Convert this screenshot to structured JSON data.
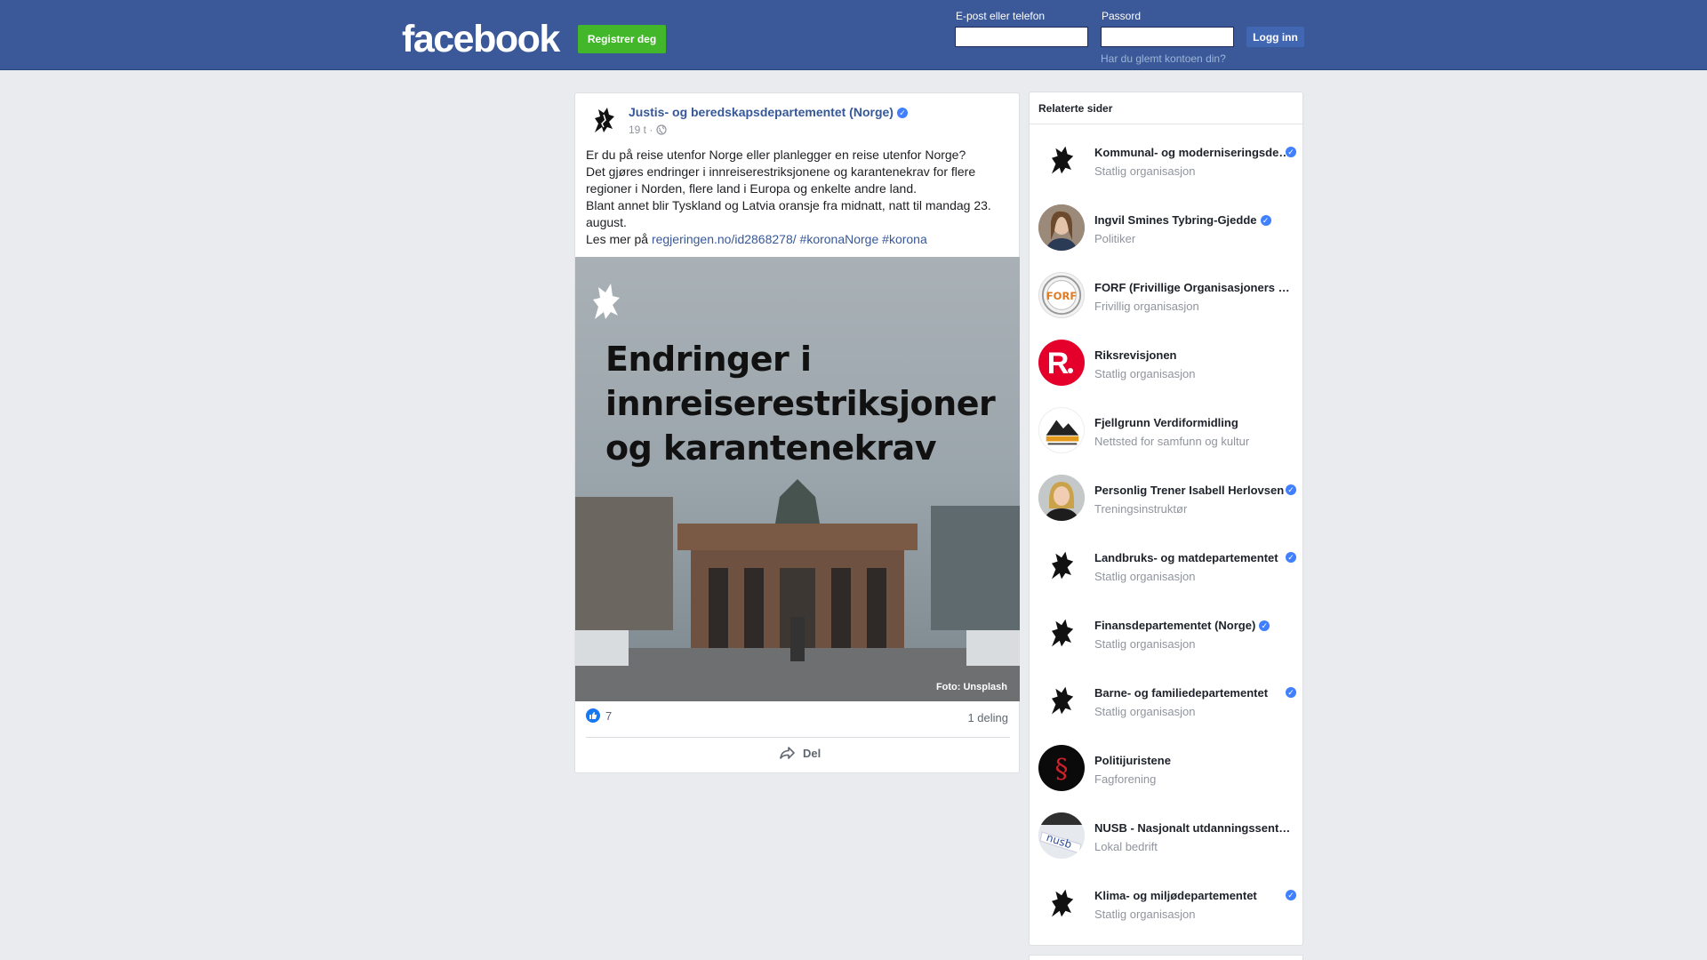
{
  "header": {
    "logo": "facebook",
    "register_label": "Registrer deg",
    "email_label": "E-post eller telefon",
    "password_label": "Passord",
    "login_label": "Logg inn",
    "forgot_label": "Har du glemt kontoen din?",
    "email_value": "",
    "password_value": ""
  },
  "post": {
    "author": "Justis- og beredskapsdepartementet (Norge)",
    "time": "19 t ·",
    "text_lines": [
      "Er du på reise utenfor Norge eller planlegger en reise utenfor Norge?",
      "Det gjøres endringer i innreiserestriksjonene og karantenekrav for flere regioner i Norden, flere land i Europa og enkelte andre land.",
      "Blant annet blir Tyskland og Latvia oransje fra midnatt, natt til mandag 23. august."
    ],
    "read_more_prefix": "Les mer på",
    "link_url": "regjeringen.no/id2868278/",
    "hashtag_1": "#koronaNorge",
    "hashtag_2": "#korona",
    "image_title": "Endringer i innreiserestriksjoner og karantenekrav",
    "image_credit": "Foto: Unsplash",
    "likes": "7",
    "shares": "1 deling",
    "share_label": "Del"
  },
  "related": {
    "title": "Relaterte sider",
    "items": [
      {
        "name": "Kommunal- og moderniseringsdepartementet",
        "category": "Statlig organisasjon",
        "verified": true,
        "avatar": "crest-icon"
      },
      {
        "name": "Ingvil Smines Tybring-Gjedde",
        "category": "Politiker",
        "verified": true,
        "avatar": "person-photo"
      },
      {
        "name": "FORF (Frivillige Organisasjoners Redningsfaglige Forum)",
        "category": "Frivillig organisasjon",
        "verified": false,
        "avatar": "forf-logo"
      },
      {
        "name": "Riksrevisjonen",
        "category": "Statlig organisasjon",
        "verified": false,
        "avatar": "riksrevisjonen-logo"
      },
      {
        "name": "Fjellgrunn Verdiformidling",
        "category": "Nettsted for samfunn og kultur",
        "verified": false,
        "avatar": "fjellgrunn-logo"
      },
      {
        "name": "Personlig Trener Isabell Herlovsen",
        "category": "Treningsinstruktør",
        "verified": true,
        "avatar": "person-photo"
      },
      {
        "name": "Landbruks- og matdepartementet",
        "category": "Statlig organisasjon",
        "verified": true,
        "avatar": "crest-icon"
      },
      {
        "name": "Finansdepartementet (Norge)",
        "category": "Statlig organisasjon",
        "verified": true,
        "avatar": "crest-icon"
      },
      {
        "name": "Barne- og familiedepartementet",
        "category": "Statlig organisasjon",
        "verified": true,
        "avatar": "crest-icon"
      },
      {
        "name": "Politijuristene",
        "category": "Fagforening",
        "verified": false,
        "avatar": "paragraph-logo"
      },
      {
        "name": "NUSB - Nasjonalt utdanningssenter for samfunnssikkerhet og beredskap",
        "category": "Lokal bedrift",
        "verified": false,
        "avatar": "nusb-logo"
      },
      {
        "name": "Klima- og miljødepartementet",
        "category": "Statlig organisasjon",
        "verified": true,
        "avatar": "crest-icon"
      }
    ]
  },
  "colors": {
    "brand_blue": "#3b5998",
    "green": "#42b72a",
    "link": "#385898",
    "verified": "#4080ff",
    "riksrevisjonen_red": "#e4002b"
  }
}
